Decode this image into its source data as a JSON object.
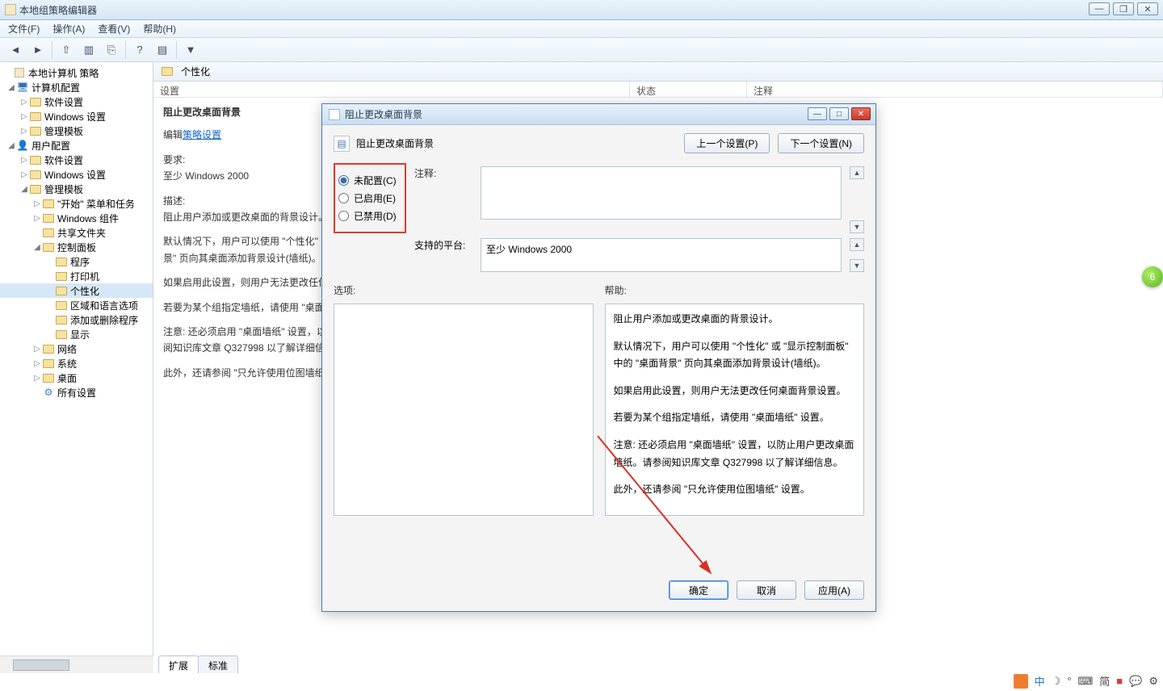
{
  "window": {
    "title": "本地组策略编辑器"
  },
  "menu": {
    "file": "文件(F)",
    "action": "操作(A)",
    "view": "查看(V)",
    "help": "帮助(H)"
  },
  "tree": {
    "root": "本地计算机 策略",
    "comp_cfg": "计算机配置",
    "sw_settings": "软件设置",
    "win_settings": "Windows 设置",
    "admin_tpl": "管理模板",
    "user_cfg": "用户配置",
    "start_task": "\"开始\" 菜单和任务",
    "win_comp": "Windows 组件",
    "shared": "共享文件夹",
    "ctrl_panel": "控制面板",
    "programs": "程序",
    "printers": "打印机",
    "personalize": "个性化",
    "region": "区域和语言选项",
    "add_remove": "添加或删除程序",
    "display": "显示",
    "network": "网络",
    "system": "系统",
    "desktop": "桌面",
    "all": "所有设置"
  },
  "crumb": {
    "label": "个性化"
  },
  "cols": {
    "setting": "设置",
    "state": "状态",
    "comment": "注释"
  },
  "detail": {
    "title": "阻止更改桌面背景",
    "edit_prefix": "编辑",
    "edit_link": "策略设置",
    "req_label": "要求:",
    "req_value": "至少 Windows 2000",
    "desc_label": "描述:",
    "desc_1": "阻止用户添加或更改桌面的背景设计。",
    "desc_2": "默认情况下，用户可以使用 \"个性化\" 或 \"显示控制面板\" 中的 \"桌面背景\" 页向其桌面添加背景设计(墙纸)。",
    "desc_3": "如果启用此设置，则用户无法更改任何桌面背景设置。",
    "desc_4": "若要为某个组指定墙纸，请使用 \"桌面墙纸\" 设置。",
    "desc_5": "注意: 还必须启用 \"桌面墙纸\" 设置，以防止用户更改桌面墙纸。请参阅知识库文章 Q327998 以了解详细信息。",
    "desc_6": "此外，还请参阅 \"只允许使用位图墙纸\" 设置。"
  },
  "tabs": {
    "extended": "扩展",
    "standard": "标准"
  },
  "dialog": {
    "title": "阻止更改桌面背景",
    "heading": "阻止更改桌面背景",
    "prev": "上一个设置(P)",
    "next": "下一个设置(N)",
    "radio_not": "未配置(C)",
    "radio_en": "已启用(E)",
    "radio_dis": "已禁用(D)",
    "comment_label": "注释:",
    "supported_label": "支持的平台:",
    "supported_value": "至少 Windows 2000",
    "options_label": "选项:",
    "help_label": "帮助:",
    "help_1": "阻止用户添加或更改桌面的背景设计。",
    "help_2": "默认情况下，用户可以使用 \"个性化\" 或 \"显示控制面板\" 中的 \"桌面背景\" 页向其桌面添加背景设计(墙纸)。",
    "help_3": "如果启用此设置，则用户无法更改任何桌面背景设置。",
    "help_4": "若要为某个组指定墙纸，请使用 \"桌面墙纸\" 设置。",
    "help_5": "注意: 还必须启用 \"桌面墙纸\" 设置，以防止用户更改桌面墙纸。请参阅知识库文章 Q327998 以了解详细信息。",
    "help_6": "此外，还请参阅 \"只允许使用位图墙纸\" 设置。",
    "ok": "确定",
    "cancel": "取消",
    "apply": "应用(A)"
  },
  "badge": {
    "green": "6"
  },
  "tray": {
    "cn": "中",
    "simp": "简"
  }
}
